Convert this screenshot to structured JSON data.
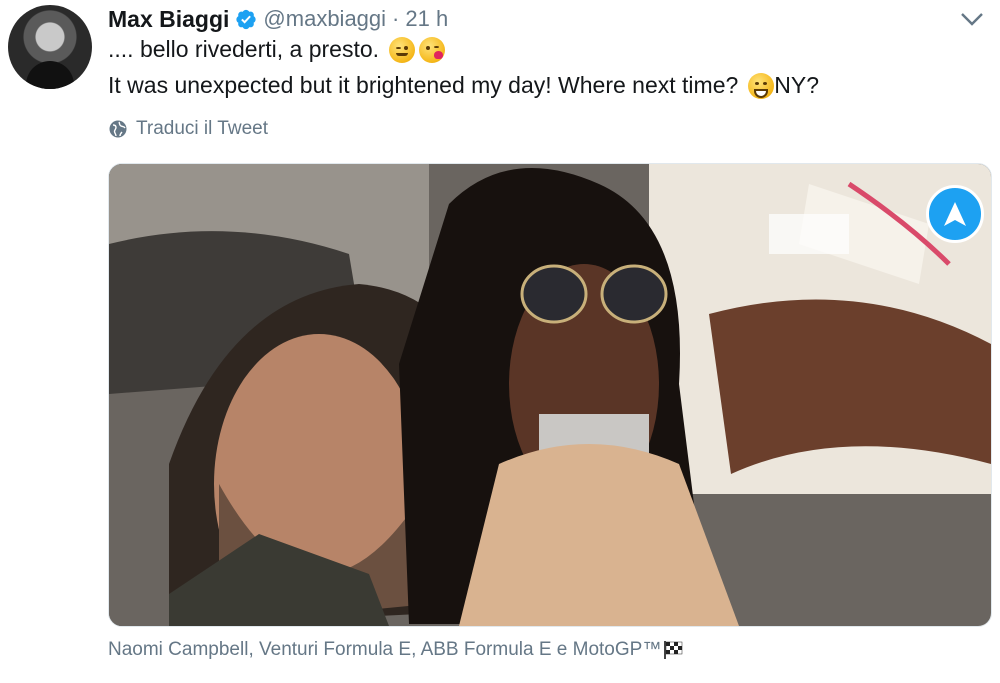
{
  "tweet": {
    "author_name": "Max Biaggi",
    "author_handle": "@maxbiaggi",
    "separator": "·",
    "time": "21 h",
    "line1_text": ".... bello rivederti, a presto.",
    "line2_text": "It was unexpected but it brightened my day! Where next time?",
    "line2_suffix": "NY?",
    "translate_label": "Traduci il Tweet",
    "tags_text": "Naomi Campbell, Venturi Formula E, ABB Formula E e MotoGP™"
  },
  "colors": {
    "verified_blue": "#1da1f2",
    "secondary_text": "#657786",
    "primary_text": "#14171a"
  },
  "icons": {
    "verified": "verified-badge-icon",
    "caret": "chevron-down-icon",
    "translate": "globe-icon",
    "media_nav": "navigation-arrow-icon",
    "emojis": [
      "winking-face-emoji",
      "face-blowing-kiss-emoji",
      "grinning-face-emoji"
    ],
    "flag": "chequered-flag-emoji"
  },
  "photo": {
    "subject": "selfie of a man and a woman with sunglasses"
  }
}
